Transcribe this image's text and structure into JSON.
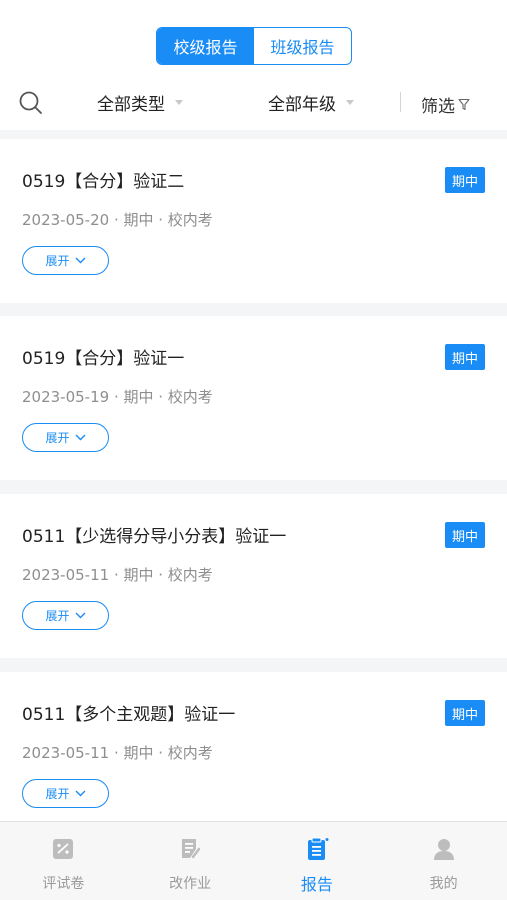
{
  "header": {
    "tabs": [
      {
        "label": "校级报告",
        "active": true
      },
      {
        "label": "班级报告",
        "active": false
      }
    ]
  },
  "filters": {
    "type": "全部类型",
    "grade": "全部年级",
    "filter_label": "筛选",
    "icons": {
      "search": "search-icon",
      "filter": "funnel-icon"
    }
  },
  "reports": [
    {
      "title": "0519【合分】验证二",
      "badge": "期中",
      "meta": "2023-05-20 · 期中 · 校内考",
      "expand": "展开"
    },
    {
      "title": "0519【合分】验证一",
      "badge": "期中",
      "meta": "2023-05-19 · 期中 · 校内考",
      "expand": "展开"
    },
    {
      "title": "0511【少选得分导小分表】验证一",
      "badge": "期中",
      "meta": "2023-05-11 · 期中 · 校内考",
      "expand": "展开"
    },
    {
      "title": "0511【多个主观题】验证一",
      "badge": "期中",
      "meta": "2023-05-11 · 期中 · 校内考",
      "expand": "展开"
    }
  ],
  "tabbar": [
    {
      "label": "评试卷",
      "icon": "grade-paper-icon",
      "active": false
    },
    {
      "label": "改作业",
      "icon": "homework-edit-icon",
      "active": false
    },
    {
      "label": "报告",
      "icon": "report-clipboard-icon",
      "active": true
    },
    {
      "label": "我的",
      "icon": "profile-icon",
      "active": false
    }
  ],
  "colors": {
    "accent": "#1a8cf5",
    "inactive": "#9a9a9a",
    "meta_text": "#8e8e8e"
  }
}
